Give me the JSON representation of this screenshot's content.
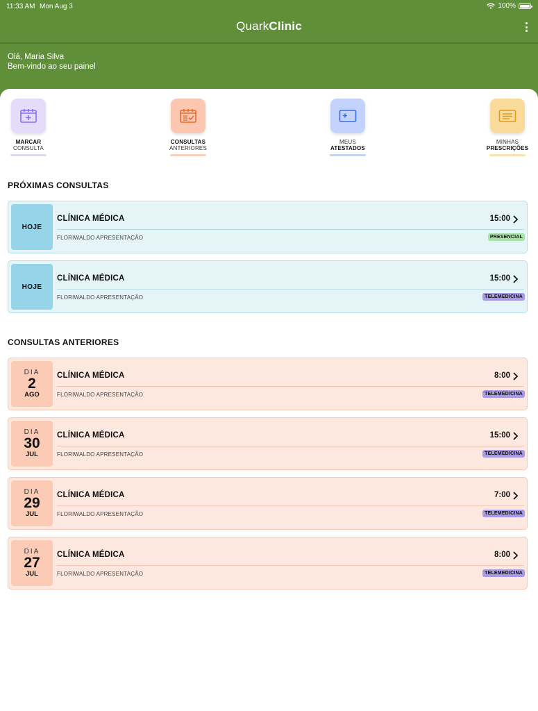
{
  "status_bar": {
    "time": "11:33 AM",
    "date": "Mon Aug 3",
    "battery": "100%"
  },
  "header": {
    "brand_light": "Quark",
    "brand_bold": "Clinic",
    "greeting_line1": "Olá, Maria Silva",
    "greeting_line2": "Bem-vindo ao seu painel"
  },
  "colors": {
    "brand_green": "#5f8f38",
    "upcoming_bg": "#e5f5f7",
    "past_bg": "#fde8df",
    "presencial_badge": "#a4e5a5",
    "telemedicina_badge": "#a99ae8"
  },
  "quick_actions": [
    {
      "line1": "MARCAR",
      "line2": "CONSULTA",
      "bold_line": 1,
      "icon": "calendar-plus-icon",
      "tile_color": "#e3dcfb",
      "icon_color": "#8a6cf0",
      "underline_color": "#dcd7f4"
    },
    {
      "line1": "CONSULTAS",
      "line2": "ANTERIORES",
      "bold_line": 1,
      "icon": "calendar-check-icon",
      "tile_color": "#fcc7b1",
      "icon_color": "#e9692c",
      "underline_color": "#f9cfc0"
    },
    {
      "line1": "MEUS",
      "line2": "ATESTADOS",
      "bold_line": 2,
      "icon": "medical-certificate-icon",
      "tile_color": "#c3d3fb",
      "icon_color": "#3f6ee0",
      "underline_color": "#c2d5ef"
    },
    {
      "line1": "MINHAS",
      "line2": "PRESCRIÇÕES",
      "bold_line": 2,
      "icon": "prescription-icon",
      "tile_color": "#fbdb9c",
      "icon_color": "#e09b19",
      "underline_color": "#f8e1b3"
    }
  ],
  "upcoming": {
    "title": "PRÓXIMAS CONSULTAS",
    "items": [
      {
        "day_label": "HOJE",
        "specialty": "CLÍNICA MÉDICA",
        "time": "15:00",
        "doctor": "FLORIWALDO APRESENTAÇÃO",
        "badge": "PRESENCIAL",
        "badge_type": "presencial"
      },
      {
        "day_label": "HOJE",
        "specialty": "CLÍNICA MÉDICA",
        "time": "15:00",
        "doctor": "FLORIWALDO APRESENTAÇÃO",
        "badge": "TELEMEDICINA",
        "badge_type": "tele"
      }
    ]
  },
  "past": {
    "title": "CONSULTAS ANTERIORES",
    "items": [
      {
        "dia": "DIA",
        "day": "2",
        "month": "AGO",
        "specialty": "CLÍNICA MÉDICA",
        "time": "8:00",
        "doctor": "FLORIWALDO APRESENTAÇÃO",
        "badge": "TELEMEDICINA",
        "badge_type": "tele"
      },
      {
        "dia": "DIA",
        "day": "30",
        "month": "JUL",
        "specialty": "CLÍNICA MÉDICA",
        "time": "15:00",
        "doctor": "FLORIWALDO APRESENTAÇÃO",
        "badge": "TELEMEDICINA",
        "badge_type": "tele"
      },
      {
        "dia": "DIA",
        "day": "29",
        "month": "JUL",
        "specialty": "CLÍNICA MÉDICA",
        "time": "7:00",
        "doctor": "FLORIWALDO APRESENTAÇÃO",
        "badge": "TELEMEDICINA",
        "badge_type": "tele"
      },
      {
        "dia": "DIA",
        "day": "27",
        "month": "JUL",
        "specialty": "CLÍNICA MÉDICA",
        "time": "8:00",
        "doctor": "FLORIWALDO APRESENTAÇÃO",
        "badge": "TELEMEDICINA",
        "badge_type": "tele"
      }
    ]
  }
}
